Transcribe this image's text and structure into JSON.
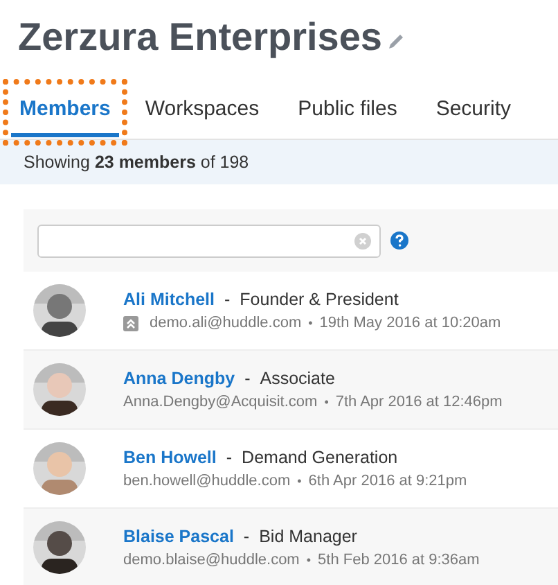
{
  "title": "Zerzura Enterprises",
  "tabs": [
    {
      "label": "Members",
      "selected": true,
      "highlighted": true
    },
    {
      "label": "Workspaces",
      "selected": false,
      "highlighted": false
    },
    {
      "label": "Public files",
      "selected": false,
      "highlighted": false
    },
    {
      "label": "Security",
      "selected": false,
      "highlighted": false
    }
  ],
  "summary": "Showing **23 members** of 198",
  "members": [
    {
      "name": "Ali Mitchell",
      "separator": "-",
      "role": "Founder & President",
      "admin": true,
      "email": "demo.ali@huddle.com",
      "dot": "•",
      "date": "19th May 2016 at 10:20am"
    },
    {
      "name": "Anna Dengby",
      "separator": "-",
      "role": "Associate",
      "admin": false,
      "email": "Anna.Dengby@Acquisit.com",
      "dot": "•",
      "date": "7th Apr 2016 at 12:46pm"
    },
    {
      "name": "Ben Howell",
      "separator": "-",
      "role": "Demand Generation",
      "admin": false,
      "email": "ben.howell@huddle.com",
      "dot": "•",
      "date": "6th Apr 2016 at 9:21pm"
    },
    {
      "name": "Blaise Pascal",
      "separator": "-",
      "role": "Bid Manager",
      "admin": false,
      "email": "demo.blaise@huddle.com",
      "dot": "•",
      "date": "5th Feb 2016 at 9:36am"
    }
  ]
}
